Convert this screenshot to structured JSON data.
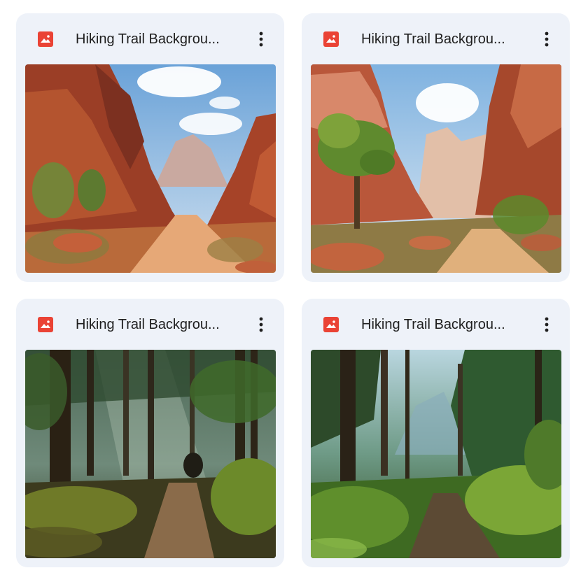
{
  "files": [
    {
      "name": "Hiking Trail Backgrou...",
      "type_icon": "image-file-icon",
      "menu_icon": "more-vert-icon",
      "thumbnail": "red-rock-canyon-trail"
    },
    {
      "name": "Hiking Trail Backgrou...",
      "type_icon": "image-file-icon",
      "menu_icon": "more-vert-icon",
      "thumbnail": "canyon-trail-with-tree"
    },
    {
      "name": "Hiking Trail Backgrou...",
      "type_icon": "image-file-icon",
      "menu_icon": "more-vert-icon",
      "thumbnail": "dark-forest-trail"
    },
    {
      "name": "Hiking Trail Backgrou...",
      "type_icon": "image-file-icon",
      "menu_icon": "more-vert-icon",
      "thumbnail": "sunlit-forest-trail"
    }
  ],
  "colors": {
    "card_bg": "#eef2f9",
    "image_icon_red": "#ea4335",
    "text": "#1f1f1f"
  }
}
